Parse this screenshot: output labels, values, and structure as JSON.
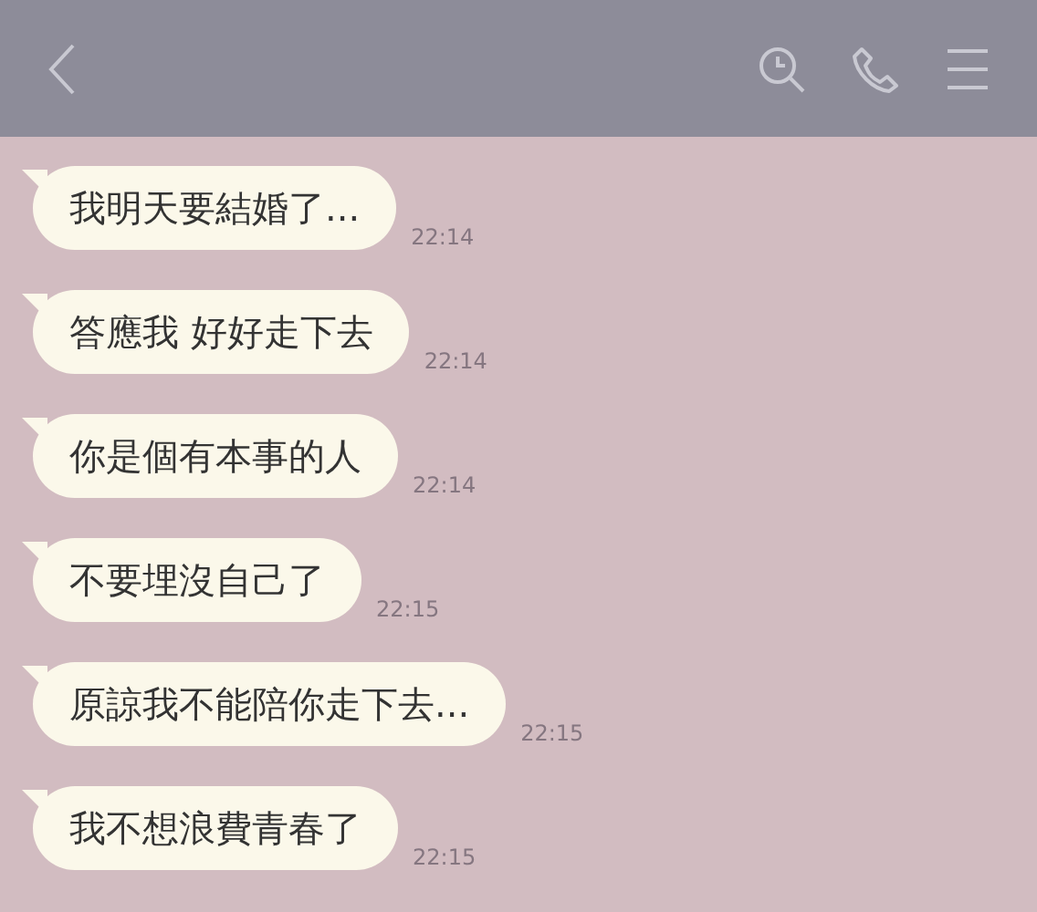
{
  "messages": [
    {
      "text": "我明天要結婚了...",
      "time": "22:14"
    },
    {
      "text": "答應我 好好走下去",
      "time": "22:14"
    },
    {
      "text": "你是個有本事的人",
      "time": "22:14"
    },
    {
      "text": "不要埋沒自己了",
      "time": "22:15"
    },
    {
      "text": "原諒我不能陪你走下去...",
      "time": "22:15"
    },
    {
      "text": "我不想浪費青春了",
      "time": "22:15"
    }
  ]
}
